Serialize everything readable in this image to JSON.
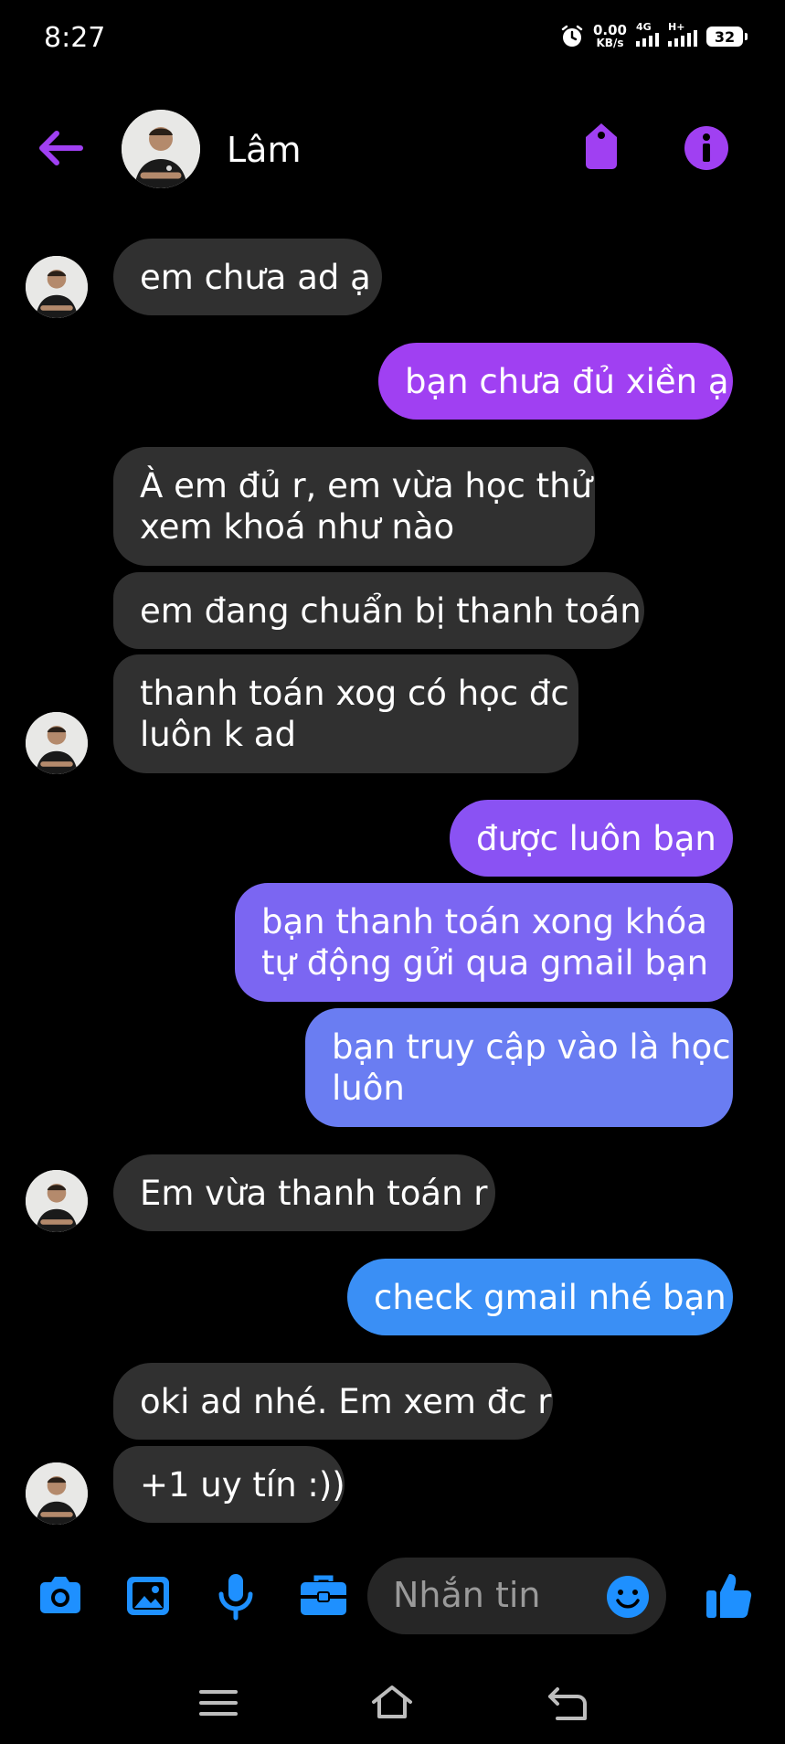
{
  "status_bar": {
    "time": "8:27",
    "net_speed_value": "0.00",
    "net_speed_unit": "KB/s",
    "sim1_label": "4G",
    "sim2_label": "H+",
    "battery": "32"
  },
  "header": {
    "contact_name": "Lâm",
    "back_icon": "arrow-left-icon",
    "tag_icon": "tag-icon",
    "info_icon": "info-icon"
  },
  "messages": [
    {
      "side": "in",
      "lines": [
        "em chưa ad ạ"
      ]
    },
    {
      "side": "out",
      "lines": [
        "bạn chưa đủ xiền ạ"
      ]
    },
    {
      "side": "in",
      "lines": [
        "À em đủ r, em vừa học thử",
        "xem khoá như nào"
      ]
    },
    {
      "side": "in",
      "lines": [
        "em đang chuẩn bị thanh toán"
      ]
    },
    {
      "side": "in",
      "lines": [
        "thanh toán xog có học đc",
        "luôn k ad"
      ]
    },
    {
      "side": "out",
      "lines": [
        "được luôn bạn"
      ]
    },
    {
      "side": "out",
      "lines": [
        "bạn thanh toán xong khóa",
        "tự động gửi qua gmail bạn"
      ]
    },
    {
      "side": "out",
      "lines": [
        "bạn truy cập vào là học",
        "luôn"
      ]
    },
    {
      "side": "in",
      "lines": [
        "Em vừa thanh toán r"
      ]
    },
    {
      "side": "out",
      "lines": [
        "check gmail nhé bạn"
      ]
    },
    {
      "side": "in",
      "lines": [
        "oki ad nhé. Em xem đc r"
      ]
    },
    {
      "side": "in",
      "lines": [
        "+1 uy tín :))"
      ]
    }
  ],
  "composer": {
    "placeholder": "Nhắn tin",
    "icons": [
      "camera-icon",
      "image-icon",
      "microphone-icon",
      "toolbox-icon",
      "emoji-icon",
      "thumbs-up-icon"
    ]
  },
  "nav_bar": {
    "icons": [
      "menu-icon",
      "home-icon",
      "back-icon"
    ]
  },
  "colors": {
    "purple": "#a040f2",
    "violet": "#7b66f2",
    "blue": "#3a8ff5",
    "incoming_bubble": "#303030",
    "composer_icon": "#1e90ff"
  }
}
